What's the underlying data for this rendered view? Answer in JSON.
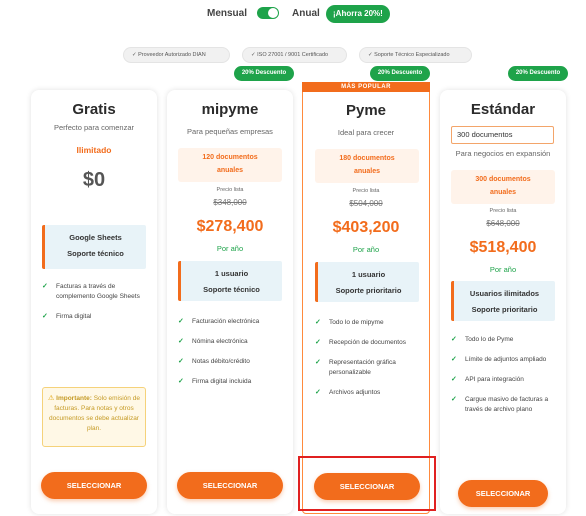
{
  "billing_toggle": {
    "monthly_label": "Mensual",
    "annual_label": "Anual",
    "save_badge": "¡Ahorra 20%!",
    "state": "annual"
  },
  "certifications": [
    "✓ Proveedor Autorizado DIAN",
    "✓ ISO 27001 / 9001 Certificado",
    "✓ Soporte Técnico Especializado"
  ],
  "discount_badges": [
    "20% Descuento",
    "20% Descuento",
    "20% Descuento"
  ],
  "plans": {
    "gratis": {
      "name": "Gratis",
      "subtitle": "Perfecto para comenzar",
      "docs": "Ilimitado",
      "price": "$0",
      "support": [
        "Google Sheets",
        "Soporte técnico"
      ],
      "features": [
        "Facturas a través de complemento Google Sheets",
        "Firma digital"
      ],
      "important_title": "Importante:",
      "important_text": "Solo emisión de facturas. Para notas y otros documentos se debe actualizar plan.",
      "button": "SELECCIONAR"
    },
    "mipyme": {
      "name": "mipyme",
      "subtitle": "Para pequeñas empresas",
      "docs": [
        "120 documentos",
        "anuales"
      ],
      "list_label": "Precio lista",
      "list_price": "$348,000",
      "price": "$278,400",
      "period": "Por año",
      "support": [
        "1 usuario",
        "Soporte técnico"
      ],
      "features": [
        "Facturación electrónica",
        "Nómina electrónica",
        "Notas débito/crédito",
        "Firma digital incluida"
      ],
      "button": "SELECCIONAR"
    },
    "pyme": {
      "popular": "MÁS POPULAR",
      "name": "Pyme",
      "subtitle": "Ideal para crecer",
      "docs": [
        "180 documentos",
        "anuales"
      ],
      "list_label": "Precio lista",
      "list_price": "$504,000",
      "price": "$403,200",
      "period": "Por año",
      "support": [
        "1 usuario",
        "Soporte prioritario"
      ],
      "features": [
        "Todo lo de mipyme",
        "Recepción de documentos",
        "Representación gráfica personalizable",
        "Archivos adjuntos"
      ],
      "button": "SELECCIONAR"
    },
    "estandar": {
      "name": "Estándar",
      "docs_input_value": "300 documentos",
      "subtitle": "Para negocios en expansión",
      "docs": [
        "300 documentos",
        "anuales"
      ],
      "list_label": "Precio lista",
      "list_price": "$648,000",
      "price": "$518,400",
      "period": "Por año",
      "support": [
        "Usuarios ilimitados",
        "Soporte prioritario"
      ],
      "features": [
        "Todo lo de Pyme",
        "Límite de adjuntos ampliado",
        "API para integración",
        "Cargue masivo de facturas a través de archivo plano"
      ],
      "button": "SELECCIONAR"
    }
  },
  "colors": {
    "accent": "#f26c1c",
    "success": "#1ea34a",
    "support_bg": "#e8f3f8",
    "highlight": "#e02020"
  }
}
